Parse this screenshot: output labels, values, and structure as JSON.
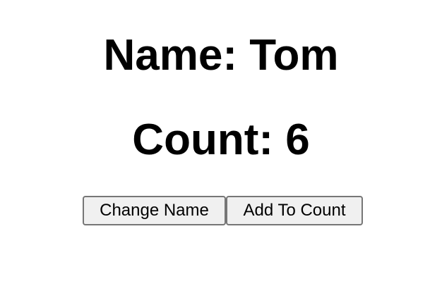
{
  "name": {
    "label": "Name: ",
    "value": "Tom"
  },
  "count": {
    "label": "Count: ",
    "value": "6"
  },
  "controls": {
    "change_name_label": "Change Name",
    "add_to_count_label": "Add To Count"
  },
  "colors": {
    "text": "#000000",
    "background": "#ffffff",
    "button_background": "#f0f0f0",
    "button_border": "#767676"
  }
}
